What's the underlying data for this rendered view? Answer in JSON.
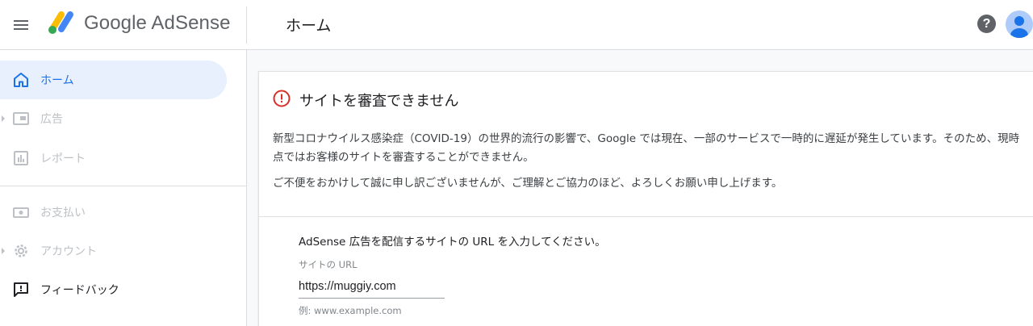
{
  "header": {
    "brand": "Google AdSense",
    "page_title": "ホーム",
    "help_glyph": "?",
    "icons": [
      "menu-icon",
      "adsense-logo-icon",
      "help-icon",
      "account-avatar-icon"
    ]
  },
  "sidebar": {
    "items": [
      {
        "label": "ホーム",
        "icon": "home-icon",
        "state": "active"
      },
      {
        "label": "広告",
        "icon": "ads-icon",
        "state": "disabled",
        "expandable": true
      },
      {
        "label": "レポート",
        "icon": "report-icon",
        "state": "disabled"
      },
      {
        "label": "お支払い",
        "icon": "payments-icon",
        "state": "disabled"
      },
      {
        "label": "アカウント",
        "icon": "gear-icon",
        "state": "disabled",
        "expandable": true
      },
      {
        "label": "フィードバック",
        "icon": "feedback-icon",
        "state": "enabled"
      }
    ]
  },
  "card": {
    "title": "サイトを審査できません",
    "message1": "新型コロナウイルス感染症（COVID-19）の世界的流行の影響で、Google では現在、一部のサービスで一時的に遅延が発生しています。そのため、現時点ではお客様のサイトを審査することができません。",
    "message2": "ご不便をおかけして誠に申し訳ございませんが、ご理解とご協力のほど、よろしくお願い申し上げます。",
    "url_prompt": "AdSense 広告を配信するサイトの URL を入力してください。",
    "url_label": "サイトの URL",
    "url_value": "https://muggiy.com",
    "url_hint": "例: www.example.com"
  },
  "colors": {
    "accent": "#1a73e8",
    "active_bg": "#e8f0fe",
    "error": "#d93025",
    "disabled_text": "#bdc1c6",
    "divider": "#dadce0"
  }
}
